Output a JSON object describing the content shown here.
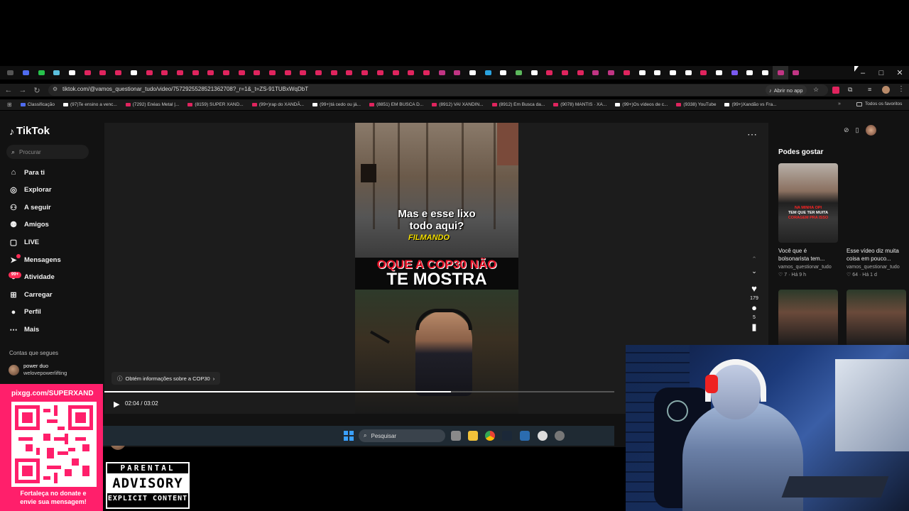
{
  "browser": {
    "url": "tiktok.com/@vamos_questionar_tudo/video/7572925528521362708?_r=1&_t=ZS-91TUBxWqDbT",
    "open_app_label": "Abrir no app",
    "window_controls": [
      "–",
      "□",
      "✕"
    ],
    "tab_favicon_colors": [
      "#555",
      "#4f6cf0",
      "#27c24c",
      "#5bc0de",
      "#ffffff",
      "#e0245e",
      "#e0245e",
      "#e0245e",
      "#ffffff",
      "#e0245e",
      "#e0245e",
      "#e0245e",
      "#e0245e",
      "#e0245e",
      "#e0245e",
      "#e0245e",
      "#e0245e",
      "#e0245e",
      "#e0245e",
      "#e0245e",
      "#e0245e",
      "#e0245e",
      "#e0245e",
      "#e0245e",
      "#e0245e",
      "#e0245e",
      "#e0245e",
      "#e0245e",
      "#c13584",
      "#c13584",
      "#ffffff",
      "#2aa3e0",
      "#ffffff",
      "#5cb85c",
      "#ffffff",
      "#e0245e",
      "#e0245e",
      "#e0245e",
      "#c13584",
      "#c13584",
      "#e0245e",
      "#ffffff",
      "#ffffff",
      "#ffffff",
      "#ffffff",
      "#e0245e",
      "#ffffff",
      "#7a5af0",
      "#ffffff",
      "#ffffff",
      "#c13584",
      "#c13584"
    ],
    "bookmarks": [
      {
        "label": "Classificação",
        "color": "#4f6cf0"
      },
      {
        "label": "(97)Te ensino a venc...",
        "color": "#ffffff"
      },
      {
        "label": "(7292) Enéas Metal |...",
        "color": "#e0245e"
      },
      {
        "label": "(8159) SUPER XAND...",
        "color": "#e0245e"
      },
      {
        "label": "(99+)rap do XANDÃ...",
        "color": "#e0245e"
      },
      {
        "label": "(99+)tá cedo ou já...",
        "color": "#ffffff"
      },
      {
        "label": "(8851) EM BUSCA D...",
        "color": "#e0245e"
      },
      {
        "label": "(8912) VAI XANDIN...",
        "color": "#e0245e"
      },
      {
        "label": "(8912) Em Busca da...",
        "color": "#e0245e"
      },
      {
        "label": "(9078) MANTIS · XA...",
        "color": "#e0245e"
      },
      {
        "label": "(99+)Os vídeos de c...",
        "color": "#ffffff"
      },
      {
        "label": "(9338) YouTube",
        "color": "#e0245e"
      },
      {
        "label": "(99+)Xandão vs Fra...",
        "color": "#ffffff"
      }
    ],
    "favorites_label": "Todos os favoritos"
  },
  "tiktok": {
    "logo": "TikTok",
    "search_placeholder": "Procurar",
    "nav": [
      {
        "label": "Para ti",
        "icon": "home-icon",
        "glyph": "⌂"
      },
      {
        "label": "Explorar",
        "icon": "compass-icon",
        "glyph": "◎"
      },
      {
        "label": "A seguir",
        "icon": "following-icon",
        "glyph": "⚇"
      },
      {
        "label": "Amigos",
        "icon": "friends-icon",
        "glyph": "⚉"
      },
      {
        "label": "LIVE",
        "icon": "live-icon",
        "glyph": "▢"
      },
      {
        "label": "Mensagens",
        "icon": "messages-icon",
        "glyph": "➤"
      },
      {
        "label": "Atividade",
        "icon": "activity-icon",
        "glyph": "●"
      },
      {
        "label": "Carregar",
        "icon": "upload-icon",
        "glyph": "⊞"
      },
      {
        "label": "Perfil",
        "icon": "profile-icon",
        "glyph": "●"
      },
      {
        "label": "Mais",
        "icon": "more-icon",
        "glyph": "⋯"
      }
    ],
    "activity_badge": "99+",
    "following_header": "Contas que segues",
    "following": {
      "name": "power duo",
      "handle": "welovepowerlifting"
    },
    "video": {
      "caption_line1": "Mas e esse lixo",
      "caption_line2": "todo aqui?",
      "caption_filmando": "FILMANDO",
      "headline_top": "OQUE A COP30 NÃO",
      "headline_bottom": "TE MOSTRA",
      "info_pill": "Obtém informações sobre a COP30",
      "time": "02:04 / 03:02",
      "progress": 0.68,
      "likes": "179",
      "comments": "5",
      "author": "vamos_questionar_tudo"
    },
    "suggestions_header": "Podes gostar",
    "suggestions": [
      {
        "title": "Você que é bolsonarista tem...",
        "author": "vamos_questionar_tudo",
        "likes": "7",
        "age": "Há 9 h",
        "thumb_text1": "NA MINHA OPI",
        "thumb_text2": "TEM QUE TER MUITA",
        "thumb_text3": "CORAGEM PRA ISSO"
      },
      {
        "title": "Esse vídeo diz muita coisa em pouco...",
        "author": "vamos_questionar_tudo",
        "likes": "64",
        "age": "Há 1 d"
      }
    ]
  },
  "taskbar": {
    "search_placeholder": "Pesquisar",
    "icons": [
      "windows-start-icon",
      "task-view-icon",
      "file-explorer-icon",
      "chrome-icon",
      "steam-icon",
      "app-icon",
      "recording-icon",
      "settings-icon"
    ]
  },
  "overlay": {
    "qr_url": "pixgg.com/SUPERXAND",
    "qr_message_1": "Fortaleça no donate e",
    "qr_message_2": "envie sua mensagem!",
    "parental_top": "PARENTAL",
    "parental_mid": "ADVISORY",
    "parental_bot": "EXPLICIT CONTENT"
  }
}
